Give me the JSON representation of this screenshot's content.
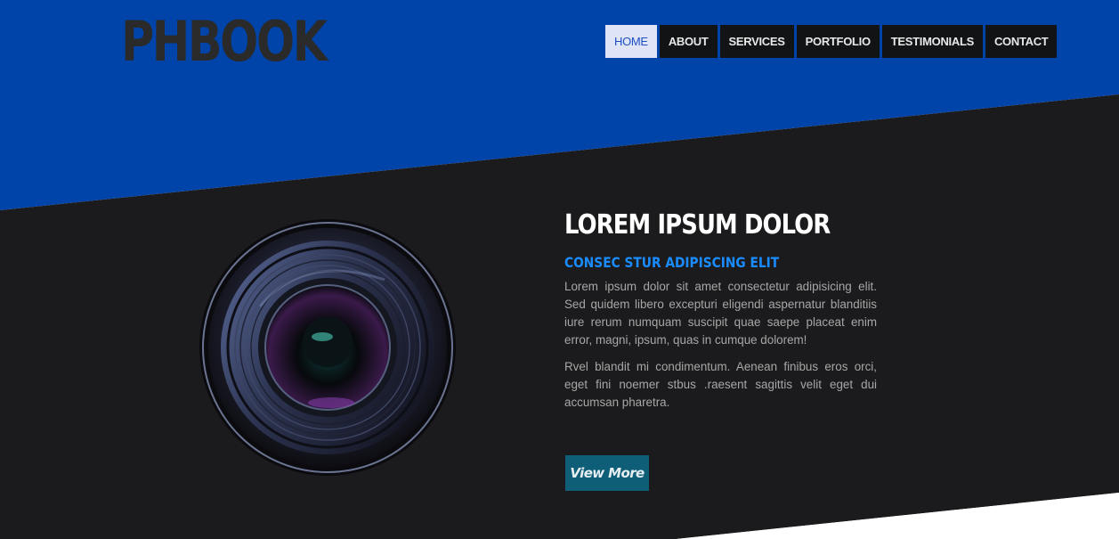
{
  "header": {
    "logo": "PHBOOK",
    "nav": [
      {
        "label": "HOME",
        "active": true
      },
      {
        "label": "ABOUT",
        "active": false
      },
      {
        "label": "SERVICES",
        "active": false
      },
      {
        "label": "PORTFOLIO",
        "active": false
      },
      {
        "label": "TESTIMONIALS",
        "active": false
      },
      {
        "label": "CONTACT",
        "active": false
      }
    ]
  },
  "hero": {
    "image_icon": "camera-lens-icon",
    "title": "LOREM IPSUM DOLOR",
    "subtitle": "CONSEC STUR ADIPISCING ELIT",
    "paragraph1": "Lorem ipsum dolor sit amet consectetur adipisicing elit. Sed quidem libero excepturi eligendi aspernatur blanditiis iure rerum numquam suscipit quae saepe placeat enim error, magni, ipsum, quas in cumque dolorem!",
    "paragraph2": "Rvel blandit mi condimentum. Aenean finibus eros orci, eget fini noemer stbus .raesent sagittis velit eget dui accumsan pharetra.",
    "button_label": "View More"
  },
  "colors": {
    "header_blue": "#0044aa",
    "dark_band": "#1b1b1d",
    "accent_blue": "#1a8cff",
    "button_teal": "#0f5e78",
    "logo_color": "#2a2a2a"
  }
}
